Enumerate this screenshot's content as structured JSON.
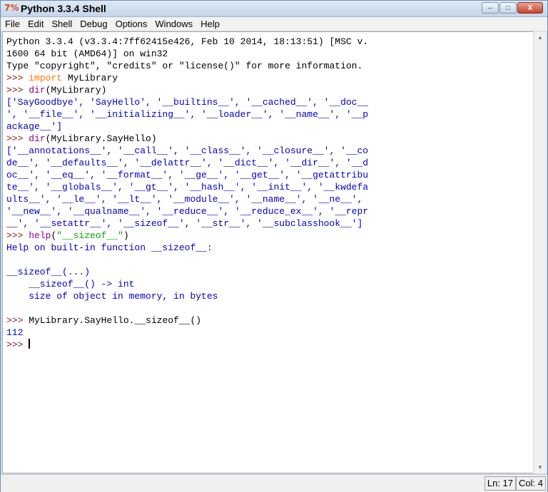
{
  "window": {
    "title": "Python 3.3.4 Shell",
    "icon_text": "7̶̶",
    "controls": {
      "minimize": "–",
      "maximize": "□",
      "close": "X"
    }
  },
  "menu": [
    "File",
    "Edit",
    "Shell",
    "Debug",
    "Options",
    "Windows",
    "Help"
  ],
  "shell": {
    "lines": [
      [
        {
          "t": "Python 3.3.4 (v3.3.4:7ff62415e426, Feb 10 2014, 18:13:51) [MSC v.",
          "c": "out"
        }
      ],
      [
        {
          "t": "1600 64 bit (AMD64)] on win32",
          "c": "out"
        }
      ],
      [
        {
          "t": "Type \"copyright\", \"credits\" or \"license()\" for more information.",
          "c": "out"
        }
      ],
      [
        {
          "t": ">>> ",
          "c": "prompt"
        },
        {
          "t": "import",
          "c": "kw"
        },
        {
          "t": " MyLibrary",
          "c": "out"
        }
      ],
      [
        {
          "t": ">>> ",
          "c": "prompt"
        },
        {
          "t": "dir",
          "c": "bi"
        },
        {
          "t": "(MyLibrary)",
          "c": "out"
        }
      ],
      [
        {
          "t": "['SayGoodbye', 'SayHello', '__builtins__', '__cached__', '__doc__",
          "c": "res"
        }
      ],
      [
        {
          "t": "', '__file__', '__initializing__', '__loader__', '__name__', '__p",
          "c": "res"
        }
      ],
      [
        {
          "t": "ackage__']",
          "c": "res"
        }
      ],
      [
        {
          "t": ">>> ",
          "c": "prompt"
        },
        {
          "t": "dir",
          "c": "bi"
        },
        {
          "t": "(MyLibrary.SayHello)",
          "c": "out"
        }
      ],
      [
        {
          "t": "['__annotations__', '__call__', '__class__', '__closure__', '__co",
          "c": "res"
        }
      ],
      [
        {
          "t": "de__', '__defaults__', '__delattr__', '__dict__', '__dir__', '__d",
          "c": "res"
        }
      ],
      [
        {
          "t": "oc__', '__eq__', '__format__', '__ge__', '__get__', '__getattribu",
          "c": "res"
        }
      ],
      [
        {
          "t": "te__', '__globals__', '__gt__', '__hash__', '__init__', '__kwdefa",
          "c": "res"
        }
      ],
      [
        {
          "t": "ults__', '__le__', '__lt__', '__module__', '__name__', '__ne__',",
          "c": "res"
        }
      ],
      [
        {
          "t": "'__new__', '__qualname__', '__reduce__', '__reduce_ex__', '__repr",
          "c": "res"
        }
      ],
      [
        {
          "t": "__', '__setattr__', '__sizeof__', '__str__', '__subclasshook__']",
          "c": "res"
        }
      ],
      [
        {
          "t": ">>> ",
          "c": "prompt"
        },
        {
          "t": "help",
          "c": "bi"
        },
        {
          "t": "(",
          "c": "out"
        },
        {
          "t": "\"__sizeof__\"",
          "c": "str"
        },
        {
          "t": ")",
          "c": "out"
        }
      ],
      [
        {
          "t": "Help on built-in function __sizeof__:",
          "c": "res"
        }
      ],
      [
        {
          "t": "",
          "c": "res"
        }
      ],
      [
        {
          "t": "__sizeof__(...)",
          "c": "res"
        }
      ],
      [
        {
          "t": "    __sizeof__() -> int",
          "c": "res"
        }
      ],
      [
        {
          "t": "    size of object in memory, in bytes",
          "c": "res"
        }
      ],
      [
        {
          "t": "",
          "c": "res"
        }
      ],
      [
        {
          "t": ">>> ",
          "c": "prompt"
        },
        {
          "t": "MyLibrary.SayHello.__sizeof__()",
          "c": "out"
        }
      ],
      [
        {
          "t": "112",
          "c": "res"
        }
      ],
      [
        {
          "t": ">>> ",
          "c": "prompt"
        }
      ]
    ]
  },
  "status": {
    "line": "Ln: 17",
    "col": "Col: 4"
  }
}
